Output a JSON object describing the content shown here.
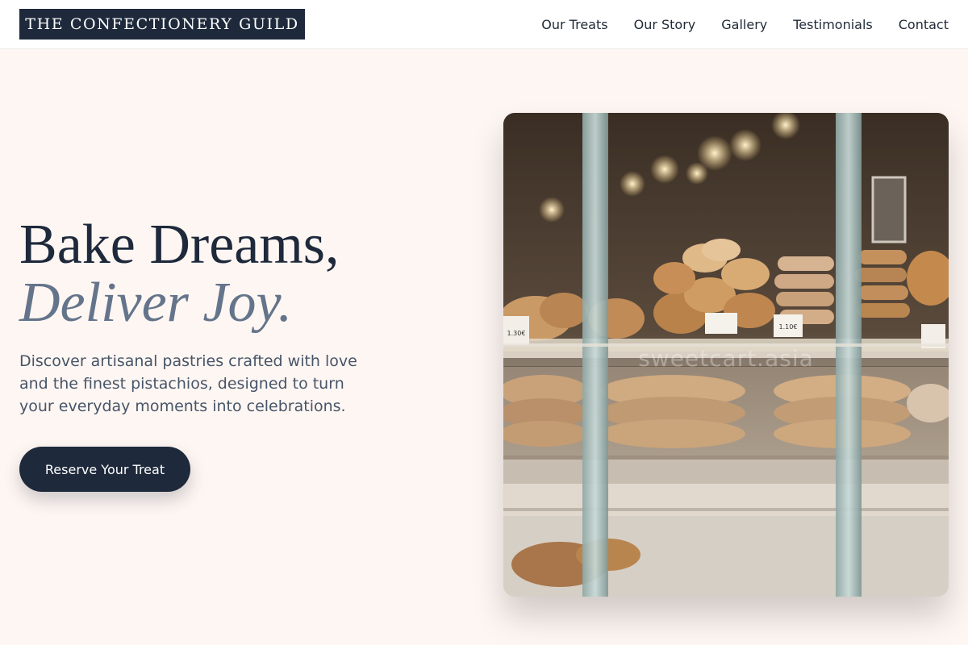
{
  "brand": {
    "name": "THE CONFECTIONERY GUILD"
  },
  "nav": {
    "items": [
      {
        "label": "Our Treats"
      },
      {
        "label": "Our Story"
      },
      {
        "label": "Gallery"
      },
      {
        "label": "Testimonials"
      },
      {
        "label": "Contact"
      }
    ]
  },
  "hero": {
    "headline_line1": "Bake Dreams,",
    "headline_line2": "Deliver Joy.",
    "subtitle": "Discover artisanal pastries crafted with love and the finest pistachios, designed to turn your everyday moments into celebrations.",
    "cta_label": "Reserve Your Treat"
  },
  "photo": {
    "watermark": "sweetcart.asia",
    "price_tags": [
      "1.30€",
      "1.10€"
    ]
  },
  "colors": {
    "page_bg": "#fef6f2",
    "brand_navy": "#1e293b",
    "accent_slate": "#64748b",
    "body_text": "#475569"
  }
}
